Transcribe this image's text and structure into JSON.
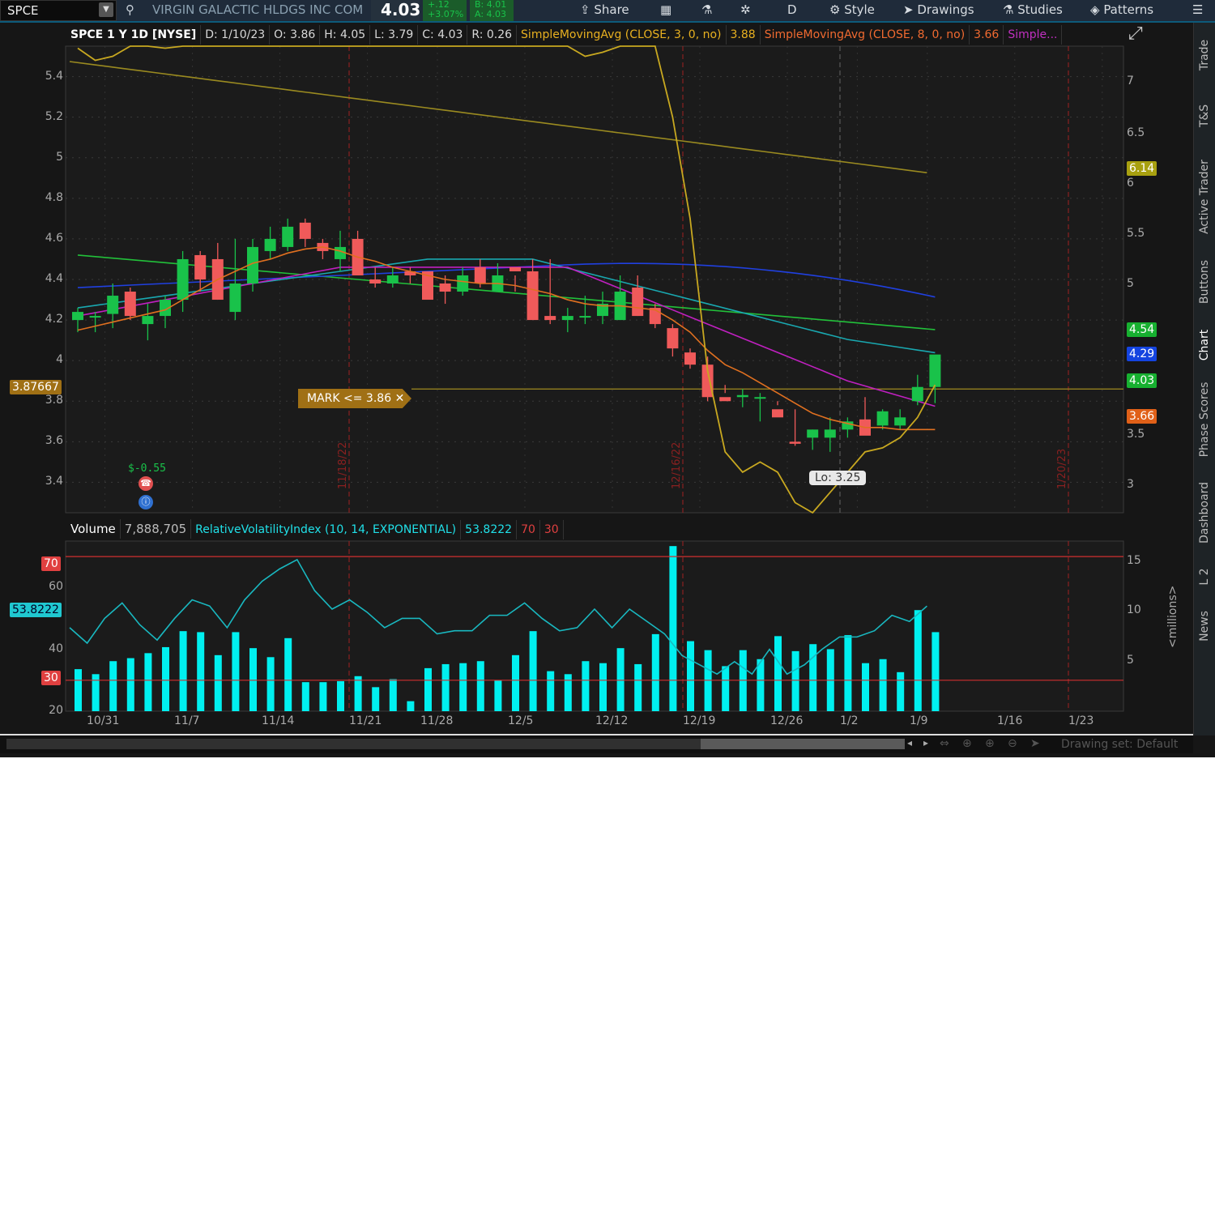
{
  "topbar": {
    "symbol": "SPCE",
    "company": "VIRGIN GALACTIC HLDGS INC COM",
    "last": "4.03",
    "change": "+.12",
    "change_pct": "+3.07%",
    "bid": "B: 4.01",
    "ask": "A: 4.03",
    "menu": {
      "share": "Share",
      "aggregation": "D",
      "style": "Style",
      "drawings": "Drawings",
      "studies": "Studies",
      "patterns": "Patterns"
    }
  },
  "chart_header": {
    "title": "SPCE 1 Y 1D [NYSE]",
    "date": "D: 1/10/23",
    "open": "O: 3.86",
    "high": "H: 4.05",
    "low": "L: 3.79",
    "close": "C: 4.03",
    "range": "R: 0.26",
    "sma1": "SimpleMovingAvg (CLOSE, 3, 0, no)",
    "sma1_val": "3.88",
    "sma2": "SimpleMovingAvg (CLOSE, 8, 0, no)",
    "sma2_val": "3.66",
    "sma3": "Simple..."
  },
  "price_axis_left": [
    "5.4",
    "5.2",
    "5",
    "4.8",
    "4.6",
    "4.4",
    "4.2",
    "4",
    "3.8",
    "3.6",
    "3.4"
  ],
  "price_axis_right": [
    "7",
    "6.5",
    "6",
    "5.5",
    "5",
    "3.5",
    "3"
  ],
  "badges": {
    "left_price": "3.87667",
    "right_6_14": "6.14",
    "right_4_54": "4.54",
    "right_4_29": "4.29",
    "right_4_03": "4.03",
    "right_3_66": "3.66",
    "rvi_value": "53.8222",
    "rvi_70": "70",
    "rvi_30": "30"
  },
  "annotations": {
    "mark": "MARK <= 3.86",
    "low": "Lo: 3.25",
    "dividend": "$-0.55",
    "vline1": "11/18/22",
    "vline2": "12/16/22",
    "vline3": "1/20/23"
  },
  "volume_header": {
    "label": "Volume",
    "value": "7,888,705",
    "study": "RelativeVolatilityIndex (10, 14, EXPONENTIAL)",
    "study_val": "53.8222",
    "upper": "70",
    "lower": "30"
  },
  "volume_axis_left": [
    "60",
    "40",
    "20"
  ],
  "volume_axis_right": [
    "15",
    "10",
    "5"
  ],
  "volume_unit": "<millions>",
  "date_axis": [
    "10/31",
    "11/7",
    "11/14",
    "11/21",
    "11/28",
    "12/5",
    "12/12",
    "12/19",
    "12/26",
    "1/2",
    "1/9",
    "1/16",
    "1/23"
  ],
  "right_rail": [
    "Trade",
    "T&S",
    "Active Trader",
    "Buttons",
    "Chart",
    "Phase Scores",
    "Dashboard",
    "L 2",
    "News"
  ],
  "footer": {
    "drawing_set": "Drawing set: Default"
  },
  "colors": {
    "up": "#19c24a",
    "down": "#f05a5a",
    "sma3": "#c8a820",
    "sma8": "#e07020",
    "volume": "#00f0f0",
    "accent": "#0d5a7a"
  },
  "chart_data": {
    "type": "candlestick",
    "x": [
      "10/28",
      "10/31",
      "11/1",
      "11/2",
      "11/3",
      "11/4",
      "11/7",
      "11/8",
      "11/9",
      "11/10",
      "11/11",
      "11/14",
      "11/15",
      "11/16",
      "11/17",
      "11/18",
      "11/21",
      "11/22",
      "11/23",
      "11/25",
      "11/28",
      "11/29",
      "11/30",
      "12/1",
      "12/2",
      "12/5",
      "12/6",
      "12/7",
      "12/8",
      "12/9",
      "12/12",
      "12/13",
      "12/14",
      "12/15",
      "12/16",
      "12/19",
      "12/20",
      "12/21",
      "12/22",
      "12/23",
      "12/27",
      "12/28",
      "12/29",
      "12/30",
      "1/3",
      "1/4",
      "1/5",
      "1/6",
      "1/9",
      "1/10"
    ],
    "open": [
      4.2,
      4.22,
      4.23,
      4.34,
      4.18,
      4.22,
      4.3,
      4.52,
      4.5,
      4.24,
      4.38,
      4.54,
      4.56,
      4.68,
      4.58,
      4.5,
      4.6,
      4.4,
      4.38,
      4.44,
      4.44,
      4.38,
      4.34,
      4.46,
      4.34,
      4.46,
      4.44,
      4.22,
      4.2,
      4.22,
      4.22,
      4.2,
      4.36,
      4.26,
      4.16,
      4.04,
      3.98,
      3.82,
      3.82,
      3.82,
      3.76,
      3.6,
      3.62,
      3.62,
      3.66,
      3.71,
      3.68,
      3.68,
      3.8,
      3.87
    ],
    "high": [
      4.26,
      4.24,
      4.38,
      4.36,
      4.28,
      4.32,
      4.54,
      4.54,
      4.58,
      4.6,
      4.6,
      4.66,
      4.7,
      4.7,
      4.6,
      4.64,
      4.64,
      4.46,
      4.46,
      4.46,
      4.44,
      4.42,
      4.46,
      4.5,
      4.48,
      4.42,
      4.5,
      4.5,
      4.26,
      4.32,
      4.34,
      4.42,
      4.42,
      4.28,
      4.18,
      4.06,
      4.02,
      3.88,
      3.86,
      3.84,
      3.8,
      3.76,
      3.66,
      3.72,
      3.72,
      3.82,
      3.76,
      3.76,
      3.93,
      3.94
    ],
    "low": [
      4.14,
      4.14,
      4.16,
      4.2,
      4.1,
      4.16,
      4.24,
      4.34,
      4.3,
      4.2,
      4.34,
      4.5,
      4.54,
      4.56,
      4.5,
      4.44,
      4.48,
      4.36,
      4.36,
      4.38,
      4.36,
      4.28,
      4.32,
      4.36,
      4.36,
      4.34,
      4.24,
      4.18,
      4.14,
      4.18,
      4.18,
      4.2,
      4.22,
      4.16,
      4.02,
      3.96,
      3.8,
      3.84,
      3.77,
      3.7,
      3.78,
      3.58,
      3.56,
      3.55,
      3.62,
      3.66,
      3.66,
      3.66,
      3.78,
      3.79
    ],
    "close": [
      4.24,
      4.22,
      4.32,
      4.22,
      4.22,
      4.3,
      4.5,
      4.4,
      4.3,
      4.38,
      4.56,
      4.6,
      4.66,
      4.6,
      4.54,
      4.56,
      4.42,
      4.38,
      4.42,
      4.42,
      4.3,
      4.34,
      4.42,
      4.38,
      4.42,
      4.44,
      4.2,
      4.2,
      4.22,
      4.22,
      4.28,
      4.34,
      4.22,
      4.18,
      4.06,
      3.98,
      3.82,
      3.8,
      3.83,
      3.82,
      3.72,
      3.59,
      3.66,
      3.66,
      3.7,
      3.63,
      3.75,
      3.72,
      3.87,
      4.03
    ],
    "sma3": [
      5.54,
      5.48,
      5.5,
      5.6,
      5.56,
      5.54,
      5.6,
      5.96,
      6.13,
      6.05,
      6.09,
      6.55,
      7.05,
      7.15,
      7.05,
      6.95,
      6.75,
      6.5,
      6.35,
      6.25,
      6.3,
      6.12,
      6.0,
      6.0,
      6.25,
      6.4,
      6.41,
      6.08,
      5.72,
      5.5,
      5.52,
      5.65,
      5.66,
      5.63,
      5.2,
      4.7,
      3.95,
      3.55,
      3.45,
      3.5,
      3.45,
      3.3,
      3.25,
      3.35,
      3.45,
      3.55,
      3.57,
      3.62,
      3.72,
      3.88
    ],
    "sma8": [
      4.15,
      4.17,
      4.19,
      4.21,
      4.23,
      4.25,
      4.3,
      4.35,
      4.4,
      4.44,
      4.48,
      4.5,
      4.53,
      4.55,
      4.56,
      4.54,
      4.51,
      4.49,
      4.46,
      4.44,
      4.42,
      4.4,
      4.39,
      4.38,
      4.38,
      4.37,
      4.35,
      4.33,
      4.3,
      4.28,
      4.27,
      4.27,
      4.26,
      4.25,
      4.2,
      4.14,
      4.05,
      3.98,
      3.94,
      3.89,
      3.84,
      3.79,
      3.74,
      3.71,
      3.69,
      3.67,
      3.67,
      3.66,
      3.66,
      3.66
    ],
    "volume_millions": [
      4.2,
      3.7,
      5.0,
      5.3,
      5.8,
      6.4,
      8.0,
      7.9,
      5.6,
      7.9,
      6.3,
      5.4,
      7.3,
      2.9,
      2.9,
      3.0,
      3.5,
      2.4,
      3.2,
      1.0,
      4.3,
      4.7,
      4.8,
      5.0,
      3.1,
      5.6,
      8.0,
      4.0,
      3.7,
      5.0,
      4.8,
      6.3,
      4.7,
      7.7,
      16.5,
      7.0,
      6.1,
      4.5,
      6.1,
      5.2,
      7.5,
      6.0,
      6.7,
      6.2,
      7.6,
      4.8,
      5.2,
      3.9,
      10.1,
      7.9
    ],
    "rvi": [
      47,
      42,
      50,
      55,
      48,
      43,
      50,
      56,
      54,
      47,
      56,
      62,
      66,
      69,
      59,
      53,
      56,
      52,
      47,
      50,
      50,
      45,
      46,
      46,
      51,
      51,
      55,
      50,
      46,
      47,
      53,
      47,
      53,
      49,
      45,
      38,
      35,
      32,
      36,
      32,
      40,
      32,
      35,
      40,
      44,
      44,
      46,
      51,
      49,
      54
    ],
    "ylim_price": [
      3.25,
      5.55
    ],
    "ylim_volume": [
      0,
      17
    ],
    "ylim_rvi": [
      20,
      75
    ]
  }
}
